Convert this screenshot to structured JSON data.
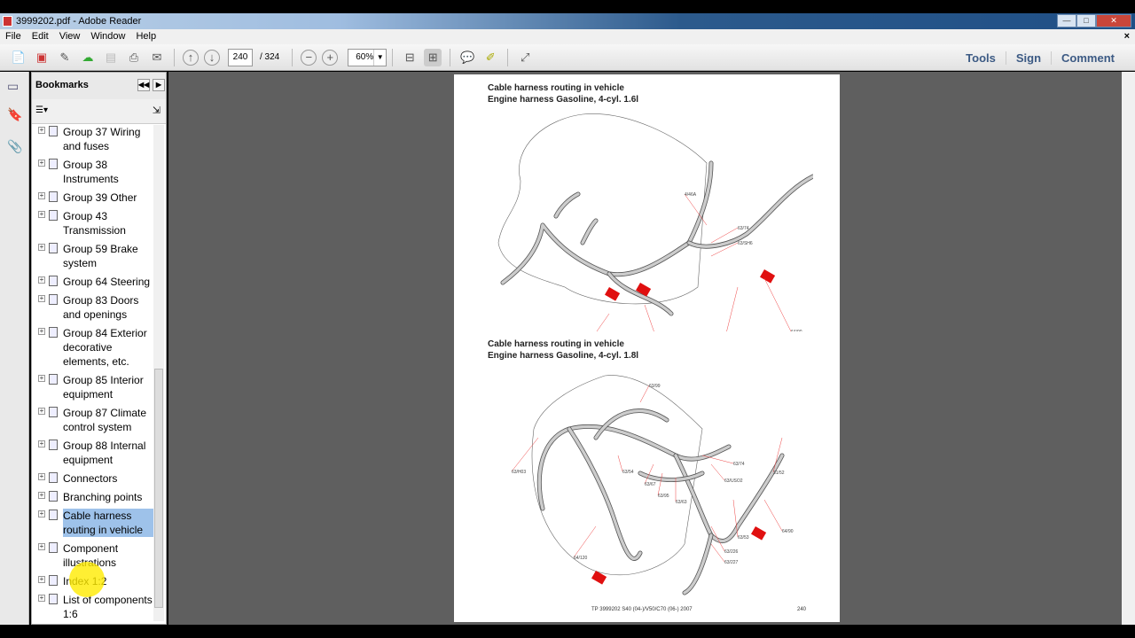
{
  "window": {
    "title": "3999202.pdf - Adobe Reader"
  },
  "menu": [
    "File",
    "Edit",
    "View",
    "Window",
    "Help"
  ],
  "toolbar": {
    "page_current": "240",
    "page_total": "/ 324",
    "zoom": "60%",
    "right_buttons": [
      "Tools",
      "Sign",
      "Comment"
    ]
  },
  "bookmarks": {
    "title": "Bookmarks",
    "items": [
      {
        "label": "Group 37 Wiring and fuses"
      },
      {
        "label": "Group 38 Instruments"
      },
      {
        "label": "Group 39 Other"
      },
      {
        "label": "Group 43 Transmission"
      },
      {
        "label": "Group 59 Brake system"
      },
      {
        "label": "Group 64 Steering"
      },
      {
        "label": "Group 83 Doors and openings"
      },
      {
        "label": "Group 84 Exterior decorative elements, etc."
      },
      {
        "label": "Group 85 Interior equipment"
      },
      {
        "label": "Group 87 Climate control system"
      },
      {
        "label": "Group 88 Internal equipment"
      },
      {
        "label": "Connectors"
      },
      {
        "label": "Branching points"
      },
      {
        "label": "Cable harness routing in vehicle",
        "selected": true
      },
      {
        "label": "Component illustrations"
      },
      {
        "label": "Index 1:2"
      },
      {
        "label": "List of components 1:6"
      }
    ]
  },
  "page": {
    "diagram1": {
      "title": "Cable harness routing in vehicle",
      "subtitle": "Engine harness Gasoline, 4-cyl. 1.6l",
      "labels": [
        "4/46A",
        "63/74",
        "63/SH6",
        "64/90",
        "63/53",
        "64/60",
        "64/120"
      ]
    },
    "diagram2": {
      "title": "Cable harness routing in vehicle",
      "subtitle": "Engine harness Gasoline, 4-cyl. 1.8l",
      "labels": [
        "63/99",
        "63/H03",
        "63/54",
        "63/74",
        "63/USO2",
        "63/67",
        "63/95",
        "63/63",
        "31/52",
        "64/90",
        "63/53",
        "63/226",
        "63/227",
        "64/120"
      ]
    },
    "footer": "TP 3999202 S40 (04-)/V50/C70 (06-) 2007",
    "page_number": "240"
  },
  "colors": {
    "accent_red": "#e01010",
    "selection": "#9ec2ea",
    "cursor_highlight": "#ffeb00"
  }
}
